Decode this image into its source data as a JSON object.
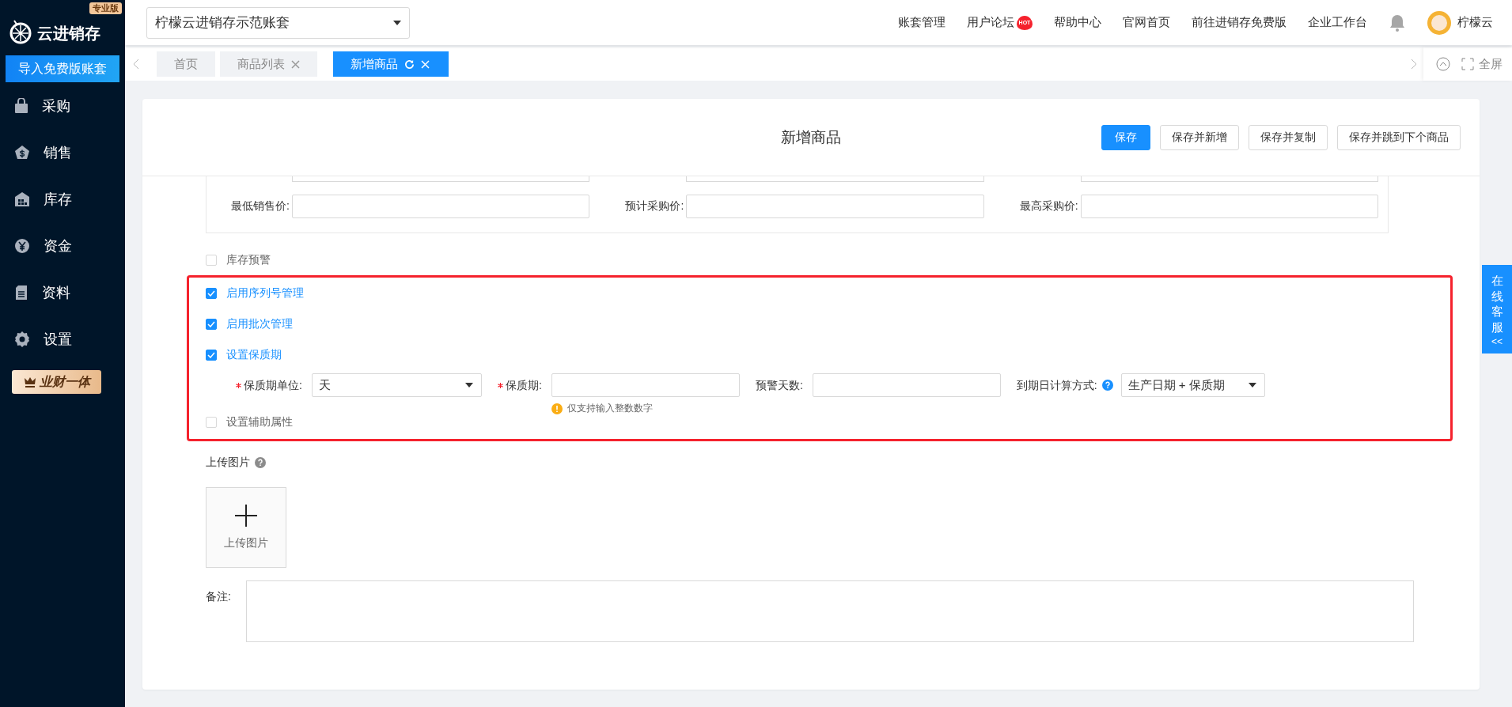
{
  "sidebar": {
    "logo": "云进销存",
    "edition_badge": "专业版",
    "import_button": "导入免费版账套",
    "items": [
      {
        "label": "采购",
        "kind": "bag"
      },
      {
        "label": "销售",
        "kind": "dollar"
      },
      {
        "label": "库存",
        "kind": "warehouse"
      },
      {
        "label": "资金",
        "kind": "yen"
      },
      {
        "label": "资料",
        "kind": "document"
      },
      {
        "label": "设置",
        "kind": "gear"
      }
    ],
    "promo_badge": "业财一体"
  },
  "topbar": {
    "account_select": "柠檬云进销存示范账套",
    "links": [
      {
        "label": "账套管理"
      },
      {
        "label": "用户论坛",
        "badge": "HOT"
      },
      {
        "label": "帮助中心"
      },
      {
        "label": "官网首页"
      },
      {
        "label": "前往进销存免费版"
      },
      {
        "label": "企业工作台"
      }
    ],
    "user_name": "柠檬云"
  },
  "tabs": [
    {
      "label": "首页",
      "selected": false,
      "closable": false,
      "refreshable": false
    },
    {
      "label": "商品列表",
      "selected": false,
      "closable": true,
      "refreshable": false
    },
    {
      "label": "新增商品",
      "selected": true,
      "closable": true,
      "refreshable": true
    }
  ],
  "fullscreen": "全屏",
  "page": {
    "title": "新增商品",
    "buttons": [
      {
        "label": "保存",
        "primary": true
      },
      {
        "label": "保存并新增",
        "primary": false
      },
      {
        "label": "保存并复制",
        "primary": false
      },
      {
        "label": "保存并跳到下个商品",
        "primary": false
      }
    ],
    "price_fields": [
      {
        "label": "最低销售价:"
      },
      {
        "label": "预计采购价:"
      },
      {
        "label": "最高采购价:"
      }
    ],
    "options": [
      {
        "label": "库存预警",
        "checked": false
      }
    ],
    "highlighted_section": {
      "options": [
        {
          "label": "启用序列号管理",
          "checked": true
        },
        {
          "label": "启用批次管理",
          "checked": true
        },
        {
          "label": "设置保质期",
          "checked": true
        }
      ],
      "shelf_life_fields": [
        {
          "kind": "select",
          "label": "保质期单位:",
          "required": true,
          "value": "天"
        },
        {
          "kind": "input",
          "label": "保质期:",
          "required": true,
          "hint": "仅支持输入整数数字"
        },
        {
          "kind": "input",
          "label": "预警天数:",
          "required": false
        },
        {
          "kind": "select",
          "label": "到期日计算方式:",
          "required": false,
          "help": true,
          "value": "生产日期 + 保质期"
        }
      ],
      "extra_options": [
        {
          "label": "设置辅助属性",
          "checked": false
        }
      ]
    },
    "upload": {
      "label": "上传图片",
      "button": "上传图片"
    },
    "remark": {
      "label": "备注:"
    }
  },
  "service_tab": {
    "label": "在线客服",
    "arrow": "<<"
  }
}
